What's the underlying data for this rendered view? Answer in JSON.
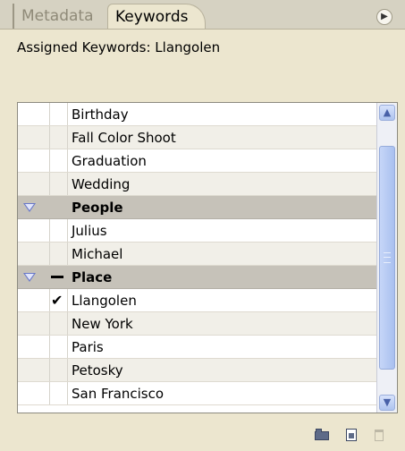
{
  "tabs": [
    {
      "label": "Metadata",
      "active": false
    },
    {
      "label": "Keywords",
      "active": true
    }
  ],
  "panel_menu_icon": "panel-menu-icon",
  "assigned": "Assigned Keywords: Llangolen",
  "keywords": [
    {
      "label": "Birthday",
      "type": "item",
      "checked": false
    },
    {
      "label": "Fall Color Shoot",
      "type": "item",
      "checked": false
    },
    {
      "label": "Graduation",
      "type": "item",
      "checked": false
    },
    {
      "label": "Wedding",
      "type": "item",
      "checked": false
    },
    {
      "label": "People",
      "type": "group",
      "expanded": true,
      "state": "none"
    },
    {
      "label": "Julius",
      "type": "item",
      "checked": false
    },
    {
      "label": "Michael",
      "type": "item",
      "checked": false
    },
    {
      "label": "Place",
      "type": "group",
      "expanded": true,
      "state": "partial"
    },
    {
      "label": "Llangolen",
      "type": "item",
      "checked": true
    },
    {
      "label": "New York",
      "type": "item",
      "checked": false
    },
    {
      "label": "Paris",
      "type": "item",
      "checked": false
    },
    {
      "label": "Petosky",
      "type": "item",
      "checked": false
    },
    {
      "label": "San Francisco",
      "type": "item",
      "checked": false
    }
  ],
  "toolbar": {
    "new_set_icon": "folder-icon",
    "new_keyword_icon": "new-keyword-icon",
    "delete_icon": "trash-icon"
  },
  "colors": {
    "panel_bg": "#ece6cf",
    "group_row_bg": "#c6c2b9",
    "scrollbar_accent": "#aec4ef",
    "disclosure_triangle": "#6a79c8"
  }
}
